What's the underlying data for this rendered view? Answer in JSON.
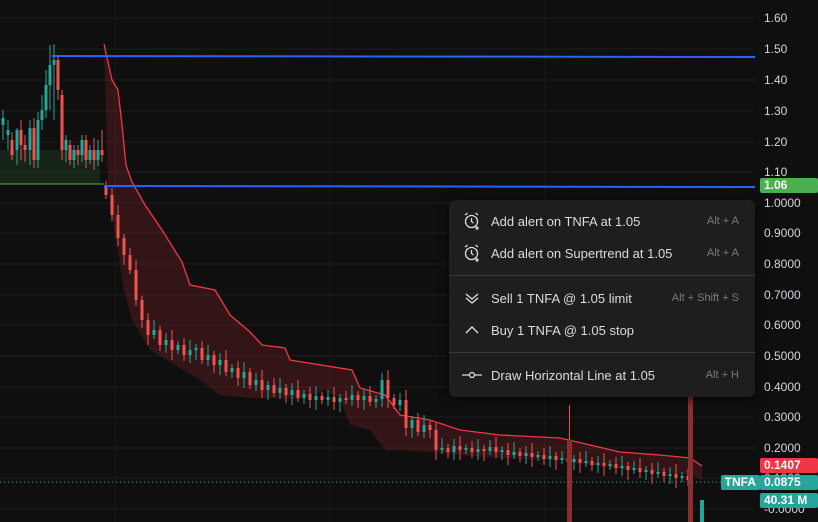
{
  "axis": {
    "ticks": [
      "1.60",
      "1.50",
      "1.40",
      "1.30",
      "1.20",
      "1.10",
      "1.0000",
      "0.9000",
      "0.8000",
      "0.7000",
      "0.6000",
      "0.5000",
      "0.4000",
      "0.3000",
      "0.2000",
      "0.1000",
      "-0.0000"
    ]
  },
  "tags": {
    "level_1": "1.06",
    "supertrend": "0.1407",
    "symbol": "TNFA",
    "last_price": "0.0875",
    "volume": "40.31 M"
  },
  "menu": {
    "items": [
      {
        "label": "Add alert on TNFA at 1.05",
        "shortcut": "Alt + A",
        "icon": "alarm-clock-add-icon"
      },
      {
        "label": "Add alert on Supertrend at 1.05",
        "shortcut": "Alt + A",
        "icon": "alarm-clock-add-icon"
      },
      {
        "label": "Sell 1 TNFA @ 1.05 limit",
        "shortcut": "Alt + Shift + S",
        "icon": "double-chevron-down-icon"
      },
      {
        "label": "Buy 1 TNFA @ 1.05 stop",
        "shortcut": "",
        "icon": "chevron-up-icon"
      },
      {
        "label": "Draw Horizontal Line at 1.05",
        "shortcut": "Alt + H",
        "icon": "horizontal-line-icon"
      }
    ]
  },
  "colors": {
    "background": "#0f0f0f",
    "up": "#26a69a",
    "down": "#ef5350",
    "hline": "#2962ff",
    "supertrend": "#f23645",
    "level_tag": "#4caf50"
  },
  "chart_data": {
    "type": "candlestick",
    "symbol": "TNFA",
    "y_scale": "log",
    "grid": true,
    "horizontal_lines": [
      1.48,
      1.05
    ],
    "last_price": 0.0875,
    "supertrend_last": 0.1407,
    "volume_last": "40.31 M"
  }
}
